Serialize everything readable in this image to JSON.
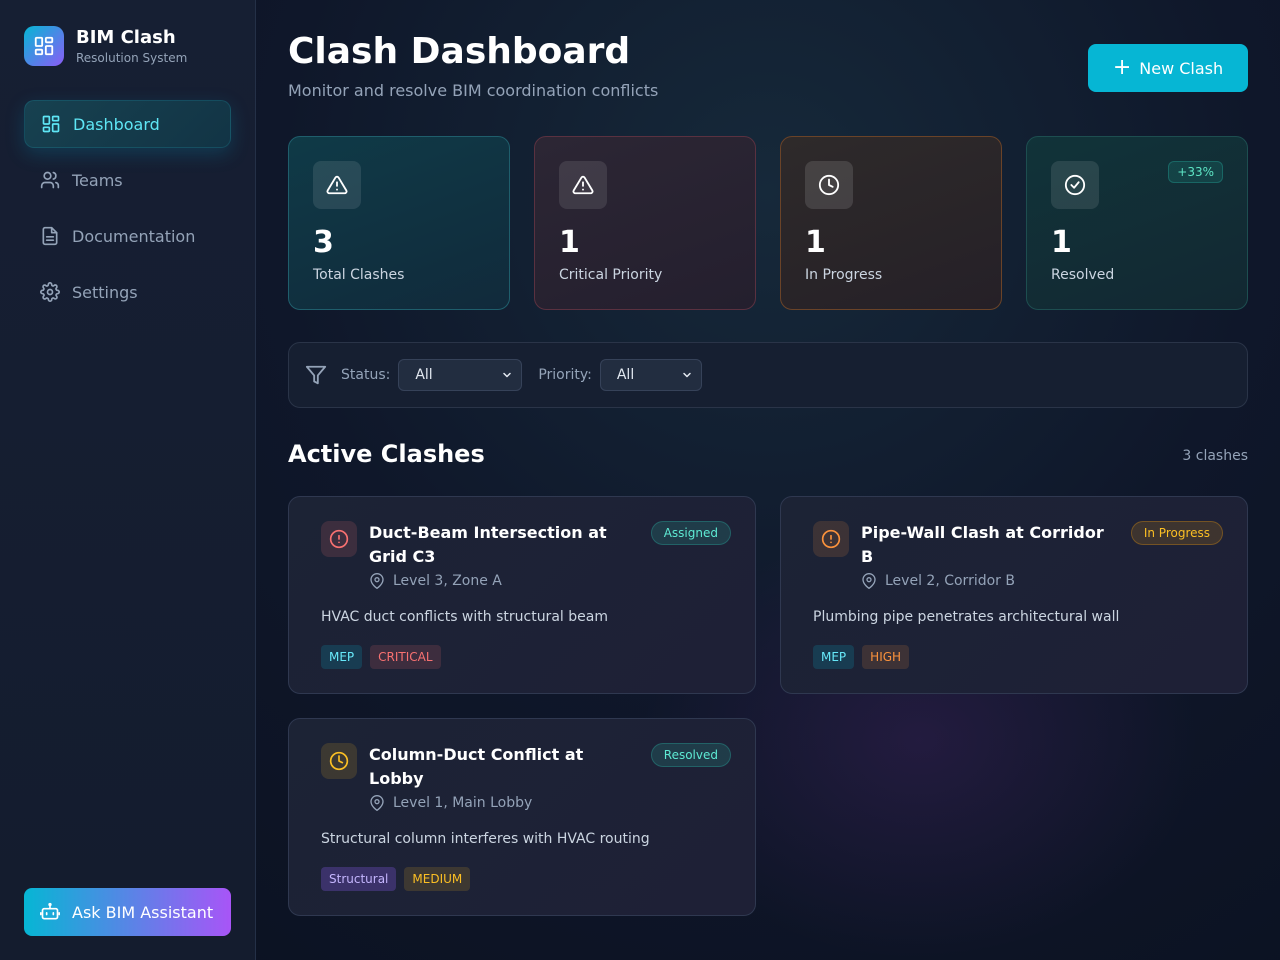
{
  "brand": {
    "title": "BIM Clash",
    "subtitle": "Resolution System"
  },
  "sidebar": {
    "items": [
      {
        "label": "Dashboard",
        "icon": "dashboard-icon",
        "active": true
      },
      {
        "label": "Teams",
        "icon": "users-icon"
      },
      {
        "label": "Documentation",
        "icon": "document-icon"
      },
      {
        "label": "Settings",
        "icon": "gear-icon"
      }
    ],
    "assistant_label": "Ask BIM Assistant"
  },
  "header": {
    "title": "Clash Dashboard",
    "subtitle": "Monitor and resolve BIM coordination conflicts",
    "new_button": "New Clash"
  },
  "stats": [
    {
      "value": "3",
      "label": "Total Clashes",
      "icon": "alert-triangle-icon"
    },
    {
      "value": "1",
      "label": "Critical Priority",
      "icon": "alert-triangle-icon"
    },
    {
      "value": "1",
      "label": "In Progress",
      "icon": "clock-icon"
    },
    {
      "value": "1",
      "label": "Resolved",
      "icon": "check-circle-icon",
      "delta": "+33%"
    }
  ],
  "filters": {
    "status_label": "Status:",
    "status_value": "All",
    "priority_label": "Priority:",
    "priority_value": "All"
  },
  "section": {
    "title": "Active Clashes",
    "count": "3 clashes"
  },
  "clashes": [
    {
      "title": "Duct-Beam Intersection at Grid C3",
      "location": "Level 3, Zone A",
      "description": "HVAC duct conflicts with structural beam",
      "status": "Assigned",
      "discipline": "MEP",
      "priority": "CRITICAL",
      "icon": "alert-circle-icon"
    },
    {
      "title": "Pipe-Wall Clash at Corridor B",
      "location": "Level 2, Corridor B",
      "description": "Plumbing pipe penetrates architectural wall",
      "status": "In Progress",
      "discipline": "MEP",
      "priority": "HIGH",
      "icon": "alert-circle-icon"
    },
    {
      "title": "Column-Duct Conflict at Lobby",
      "location": "Level 1, Main Lobby",
      "description": "Structural column interferes with HVAC routing",
      "status": "Resolved",
      "discipline": "Structural",
      "priority": "MEDIUM",
      "icon": "clock-icon"
    }
  ],
  "colors": {
    "accent": "#06b6d4",
    "critical": "#f87171",
    "high": "#fb923c",
    "medium": "#fbbf24",
    "resolved": "#2dd4bf"
  }
}
